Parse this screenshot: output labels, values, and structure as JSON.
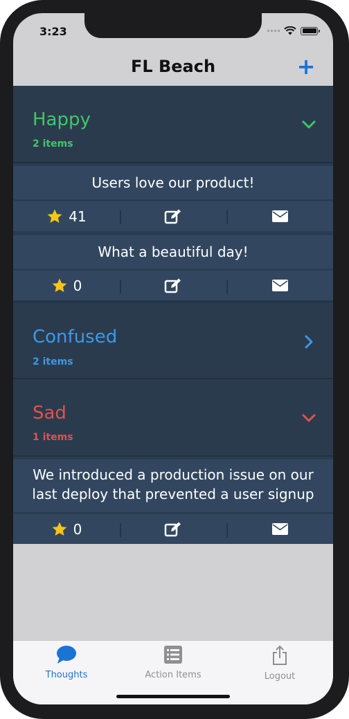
{
  "status_bar": {
    "time": "3:23"
  },
  "nav": {
    "title": "FL Beach",
    "add_label": "+"
  },
  "columns": [
    {
      "title": "Happy",
      "count_label": "2 items",
      "color": "#3cc968",
      "expanded": true,
      "chevron": "chevron-down-icon",
      "thoughts": [
        {
          "text": "Users love our product!",
          "stars": "41"
        },
        {
          "text": "What a beautiful day!",
          "stars": "0"
        }
      ]
    },
    {
      "title": "Confused",
      "count_label": "2 items",
      "color": "#3a9ae6",
      "expanded": false,
      "chevron": "chevron-right-icon",
      "thoughts": []
    },
    {
      "title": "Sad",
      "count_label": "1 items",
      "color": "#e2524a",
      "expanded": true,
      "chevron": "chevron-down-icon",
      "thoughts": [
        {
          "text": "We introduced a production issue on our last deploy that prevented a user signup",
          "stars": "0"
        }
      ]
    }
  ],
  "tabs": [
    {
      "label": "Thoughts",
      "icon": "speech-bubble-icon",
      "active": true
    },
    {
      "label": "Action Items",
      "icon": "list-icon",
      "active": false
    },
    {
      "label": "Logout",
      "icon": "share-icon",
      "active": false
    }
  ],
  "colors": {
    "active_tab": "#1a74d6",
    "inactive_tab": "#8e8e93",
    "star": "#f5c518"
  }
}
